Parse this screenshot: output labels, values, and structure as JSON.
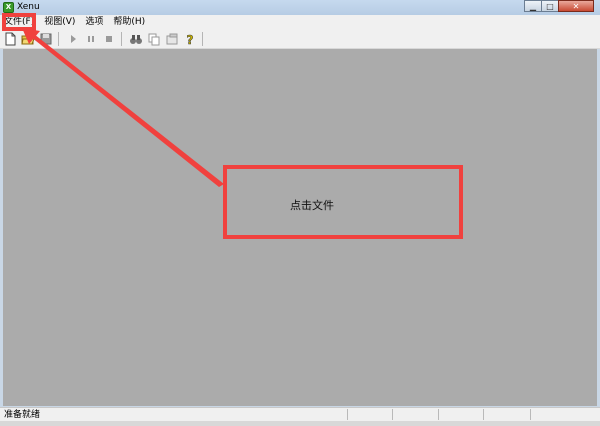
{
  "window": {
    "title": "Xenu",
    "app_icon": "xenu-app-icon"
  },
  "menu": {
    "items": [
      "文件(F)",
      "视图(V)",
      "选项",
      "帮助(H)"
    ]
  },
  "toolbar": {
    "icons": [
      "new-file-icon",
      "open-folder-icon",
      "save-icon",
      "play-icon",
      "pause-icon",
      "stop-icon",
      "find-binoculars-icon",
      "copy-icon",
      "properties-icon",
      "help-icon"
    ]
  },
  "status": {
    "text": "准备就绪"
  },
  "annotation": {
    "text": "点击文件",
    "color": "#f0413e"
  }
}
